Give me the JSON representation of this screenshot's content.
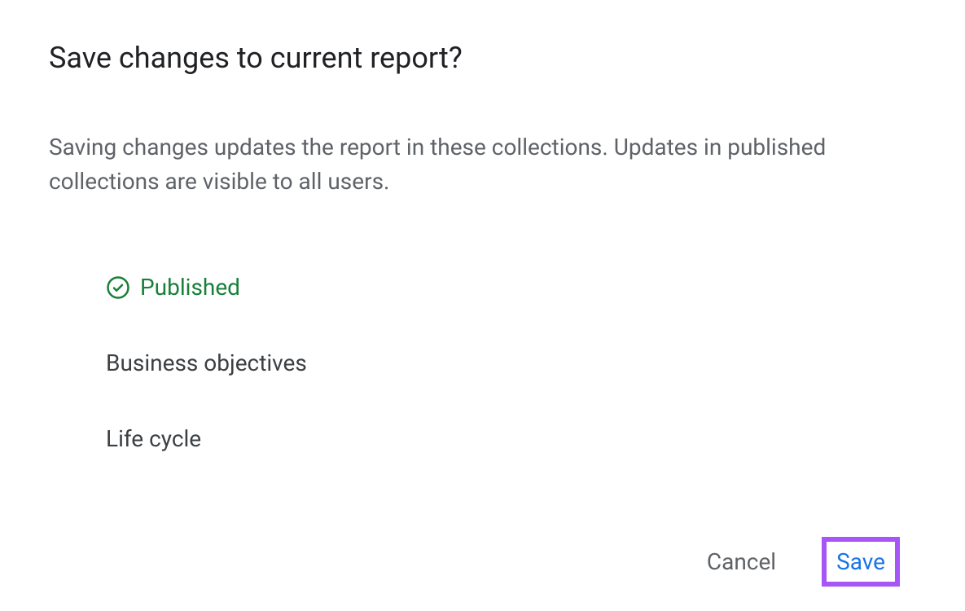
{
  "dialog": {
    "title": "Save changes to current report?",
    "description": "Saving changes updates the report in these collections. Updates in published collections are visible to all users.",
    "status": {
      "label": "Published"
    },
    "collections": [
      "Business objectives",
      "Life cycle"
    ],
    "actions": {
      "cancel": "Cancel",
      "save": "Save"
    }
  }
}
